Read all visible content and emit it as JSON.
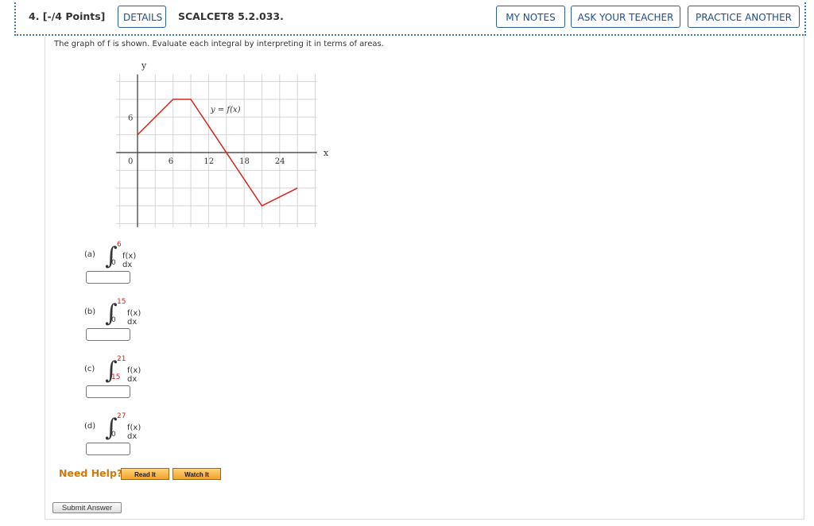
{
  "header": {
    "question_number": "4.  [-/4 Points]",
    "details_label": "DETAILS",
    "code": "SCALCET8 5.2.033.",
    "my_notes_label": "MY NOTES",
    "ask_teacher_label": "ASK YOUR TEACHER",
    "practice_label": "PRACTICE ANOTHER",
    "border_color": "#3b78b4",
    "button_color": "#1f4f8b"
  },
  "prompt": "The graph of f is shown. Evaluate each integral by interpreting it in terms of areas.",
  "graph": {
    "x_axis_label": "x",
    "y_axis_label": "y",
    "function_label": "y = f(x)",
    "x_ticks": [
      "0",
      "6",
      "12",
      "18",
      "24"
    ],
    "y_ticks": [
      "6"
    ],
    "line_color": "#d9231f",
    "points": [
      [
        0,
        3
      ],
      [
        6,
        9
      ],
      [
        9,
        9
      ],
      [
        21,
        -9
      ],
      [
        27,
        -6
      ]
    ]
  },
  "parts": [
    {
      "label": "(a)",
      "lower": "0",
      "upper": "6",
      "integrand": "f(x) dx",
      "value": ""
    },
    {
      "label": "(b)",
      "lower": "0",
      "upper": "15",
      "integrand": "f(x) dx",
      "value": ""
    },
    {
      "label": "(c)",
      "lower": "15",
      "upper": "21",
      "integrand": "f(x) dx",
      "value": ""
    },
    {
      "label": "(d)",
      "lower": "0",
      "upper": "27",
      "integrand": "f(x) dx",
      "value": ""
    }
  ],
  "help": {
    "need_help_label": "Need Help?",
    "read_it_label": "Read It",
    "watch_it_label": "Watch It"
  },
  "submit_label": "Submit Answer"
}
